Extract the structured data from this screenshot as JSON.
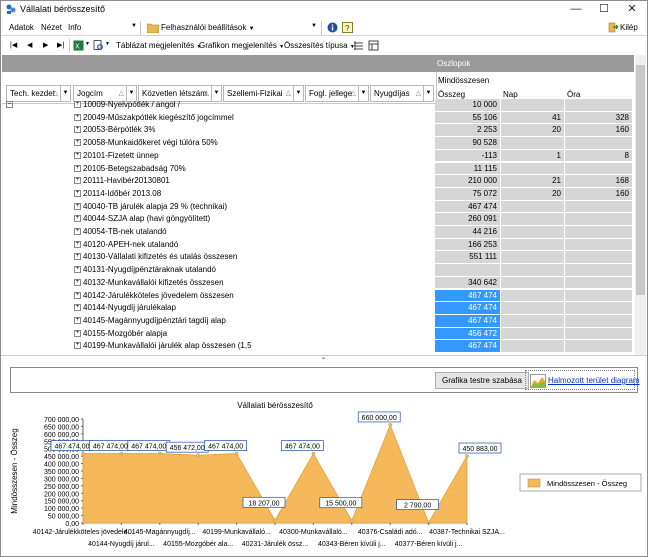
{
  "window": {
    "title": "Vállalati bérösszesítő"
  },
  "menu": {
    "items": [
      "Adatok",
      "Nézet",
      "Info"
    ],
    "prefs": "Felhasználói beállítások",
    "exit": "Kilép"
  },
  "toolbar": {
    "table_view": "Táblázat megjelenítés",
    "chart_view": "Grafikon megjelenítés",
    "summary_type": "Összesítés típusa"
  },
  "grid": {
    "header": "Oszlopok",
    "row_fields": [
      "Tech. kezdet",
      "Jogcím",
      "Közvetlen létszám",
      "Szellemi-Fizikai",
      "Fogl. jellege",
      "Nyugdíjas"
    ],
    "value_group": "Mindösszesen",
    "value_cols": [
      "Összeg",
      "Nap",
      "Óra"
    ],
    "rows": [
      {
        "label": "10009-Nyelvpótlék / angol /",
        "osszeg": "10 000",
        "nap": "",
        "ora": "",
        "sel": false
      },
      {
        "label": "20049-Műszakpótlék kiegészítő jogcímmel",
        "osszeg": "55 106",
        "nap": "41",
        "ora": "328",
        "sel": false
      },
      {
        "label": "20053-Bérpótlék 3%",
        "osszeg": "2 253",
        "nap": "20",
        "ora": "160",
        "sel": false
      },
      {
        "label": "20058-Munkaidőkeret végi túlóra 50%",
        "osszeg": "90 528",
        "nap": "",
        "ora": "",
        "sel": false
      },
      {
        "label": "20101-Fizetett ünnep",
        "osszeg": "-113",
        "nap": "1",
        "ora": "8",
        "sel": false
      },
      {
        "label": "20105-Betegszabadság 70%",
        "osszeg": "11 115",
        "nap": "",
        "ora": "",
        "sel": false
      },
      {
        "label": "20111-Havibér20130801",
        "osszeg": "210 000",
        "nap": "21",
        "ora": "168",
        "sel": false
      },
      {
        "label": "20114-Időbér 2013.08",
        "osszeg": "75 072",
        "nap": "20",
        "ora": "160",
        "sel": false
      },
      {
        "label": "40040-TB járulék alapja 29 % (technikai)",
        "osszeg": "467 474",
        "nap": "",
        "ora": "",
        "sel": false
      },
      {
        "label": "40044-SZJA alap (havi göngyölített)",
        "osszeg": "260 091",
        "nap": "",
        "ora": "",
        "sel": false
      },
      {
        "label": "40054-TB-nek utalandó",
        "osszeg": "44 216",
        "nap": "",
        "ora": "",
        "sel": false
      },
      {
        "label": "40120-APEH-nek utalandó",
        "osszeg": "166 253",
        "nap": "",
        "ora": "",
        "sel": false
      },
      {
        "label": "40130-Vállalati kifizetés és utalás összesen",
        "osszeg": "551 111",
        "nap": "",
        "ora": "",
        "sel": false
      },
      {
        "label": "40131-Nyugdíjpénztáraknak utalandó",
        "osszeg": "",
        "nap": "",
        "ora": "",
        "sel": false
      },
      {
        "label": "40132-Munkavállalói kifizetés összesen",
        "osszeg": "340 642",
        "nap": "",
        "ora": "",
        "sel": false
      },
      {
        "label": "40142-Járulékköteles jövedelem összesen",
        "osszeg": "467 474",
        "nap": "",
        "ora": "",
        "sel": true
      },
      {
        "label": "40144-Nyugdíj járulékalap",
        "osszeg": "467 474",
        "nap": "",
        "ora": "",
        "sel": true
      },
      {
        "label": "40145-Magánnyugdíjpénztári tagdíj alap",
        "osszeg": "467 474",
        "nap": "",
        "ora": "",
        "sel": true
      },
      {
        "label": "40155-Mozgóbér alapja",
        "osszeg": "456 472",
        "nap": "",
        "ora": "",
        "sel": true
      },
      {
        "label": "40199-Munkavállalói járulék alap összesen (1,5",
        "osszeg": "467 474",
        "nap": "",
        "ora": "",
        "sel": true
      }
    ]
  },
  "chart_controls": {
    "fit_button": "Grafika testre szabása",
    "chart_type_link": "Halmozott terület diagram"
  },
  "chart_data": {
    "type": "area",
    "title": "Vállalati bérösszesítő",
    "ylabel": "Mindösszesen - Összeg",
    "ylim": [
      0,
      700000
    ],
    "yticks": [
      "0,00",
      "50 000,00",
      "100 000,00",
      "150 000,00",
      "200 000,00",
      "250 000,00",
      "300 000,00",
      "350 000,00",
      "400 000,00",
      "450 000,00",
      "500 000,00",
      "550 000,00",
      "600 000,00",
      "650 000,00",
      "700 000,00"
    ],
    "categories": [
      "40142-Járulékköteles jövedele...",
      "40144-Nyugdíj járul...",
      "40145-Magánnyugdíj...",
      "40155-Mozgóbér ala...",
      "40199-Munkavállaló...",
      "40231-Járulék össz...",
      "40300-Munkavállaló...",
      "40343-Béren kívüli j...",
      "40376-Családi adó...",
      "40377-Béren kívüli j...",
      "40387-Technikai SZJA..."
    ],
    "values": [
      467474,
      467474,
      467474,
      456472,
      467474,
      18207,
      467474,
      15500,
      660000,
      2790,
      450883
    ],
    "data_labels": [
      "467 474,00",
      "467 474,00",
      "467 474,00",
      "456 472,00",
      "467 474,00",
      "18 207,00",
      "467 474,00",
      "15 500,00",
      "660 000,00",
      "2 790,00",
      "450 883,00"
    ],
    "series": [
      {
        "name": "Mindösszesen - Összeg"
      }
    ],
    "color": "#f5b95c",
    "legend": "right"
  }
}
